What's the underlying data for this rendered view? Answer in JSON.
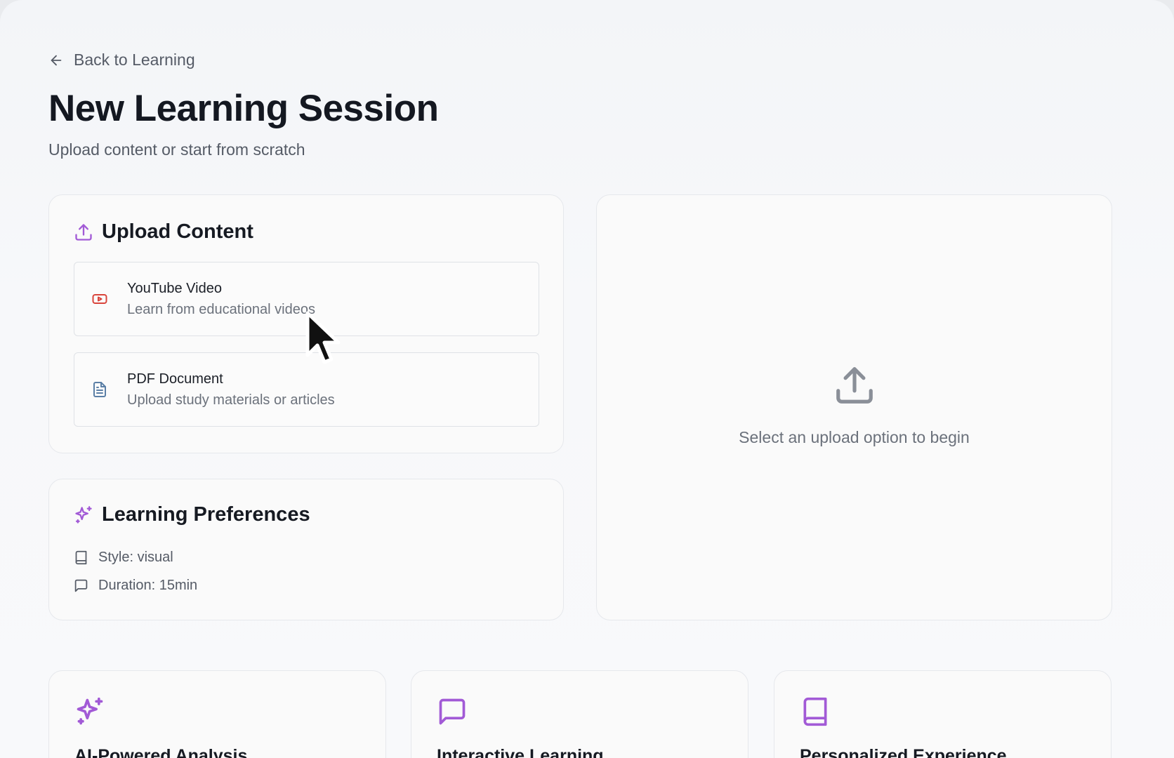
{
  "nav": {
    "back_label": "Back to Learning"
  },
  "header": {
    "title": "New Learning Session",
    "subtitle": "Upload content or start from scratch"
  },
  "upload": {
    "heading": "Upload Content",
    "options": [
      {
        "title": "YouTube Video",
        "description": "Learn from educational videos",
        "icon": "youtube-icon"
      },
      {
        "title": "PDF Document",
        "description": "Upload study materials or articles",
        "icon": "document-icon"
      }
    ]
  },
  "preferences": {
    "heading": "Learning Preferences",
    "items": [
      {
        "label": "Style: visual",
        "icon": "book-icon"
      },
      {
        "label": "Duration: 15min",
        "icon": "message-icon"
      }
    ]
  },
  "dropzone": {
    "message": "Select an upload option to begin",
    "icon": "upload-icon"
  },
  "features": [
    {
      "title": "AI-Powered Analysis",
      "icon": "sparkles-icon"
    },
    {
      "title": "Interactive Learning",
      "icon": "message-icon"
    },
    {
      "title": "Personalized Experience",
      "icon": "book-icon"
    }
  ],
  "colors": {
    "accent": "#a25ad6",
    "youtube": "#d9443b",
    "pdf": "#5b7fa6",
    "text_primary": "#141821",
    "text_muted": "#555b66"
  }
}
